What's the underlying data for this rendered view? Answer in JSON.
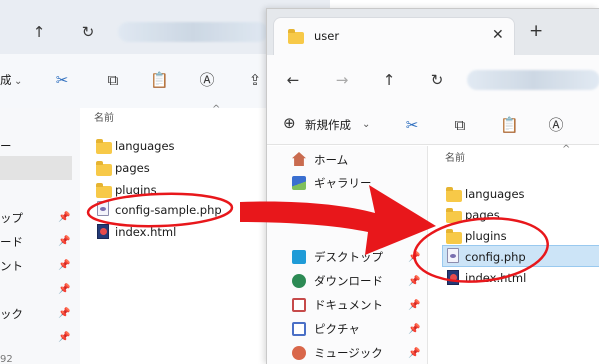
{
  "back_window": {
    "nav": {
      "up": "↑",
      "refresh": "↻"
    },
    "toolbar": {
      "new_partial": "成"
    },
    "header_name": "名前",
    "files": [
      {
        "name": "languages",
        "type": "folder"
      },
      {
        "name": "pages",
        "type": "folder"
      },
      {
        "name": "plugins",
        "type": "folder"
      },
      {
        "name": "config-sample.php",
        "type": "php"
      },
      {
        "name": "index.html",
        "type": "html"
      }
    ],
    "sidebar_partial": [
      "ー",
      "ップ",
      "ード",
      "ント",
      "ック"
    ],
    "bottom_partial": "92"
  },
  "front_window": {
    "tab_title": "user",
    "toolbar": {
      "new_label": "新規作成"
    },
    "header_name": "名前",
    "sidebar": [
      {
        "label": "ホーム",
        "icon": "home-icon"
      },
      {
        "label": "ギャラリー",
        "icon": "gallery-icon"
      },
      {
        "label": "デスクトップ",
        "icon": "desktop-icon"
      },
      {
        "label": "ダウンロード",
        "icon": "download-icon"
      },
      {
        "label": "ドキュメント",
        "icon": "documents-icon"
      },
      {
        "label": "ピクチャ",
        "icon": "pictures-icon"
      },
      {
        "label": "ミュージック",
        "icon": "music-icon"
      }
    ],
    "files": [
      {
        "name": "languages",
        "type": "folder"
      },
      {
        "name": "pages",
        "type": "folder"
      },
      {
        "name": "plugins",
        "type": "folder"
      },
      {
        "name": "config.php",
        "type": "php",
        "selected": true
      },
      {
        "name": "index.html",
        "type": "html"
      }
    ]
  },
  "colors": {
    "annotation_red": "#e8171b",
    "selection": "#cce4f7",
    "folder": "#f7c948"
  }
}
